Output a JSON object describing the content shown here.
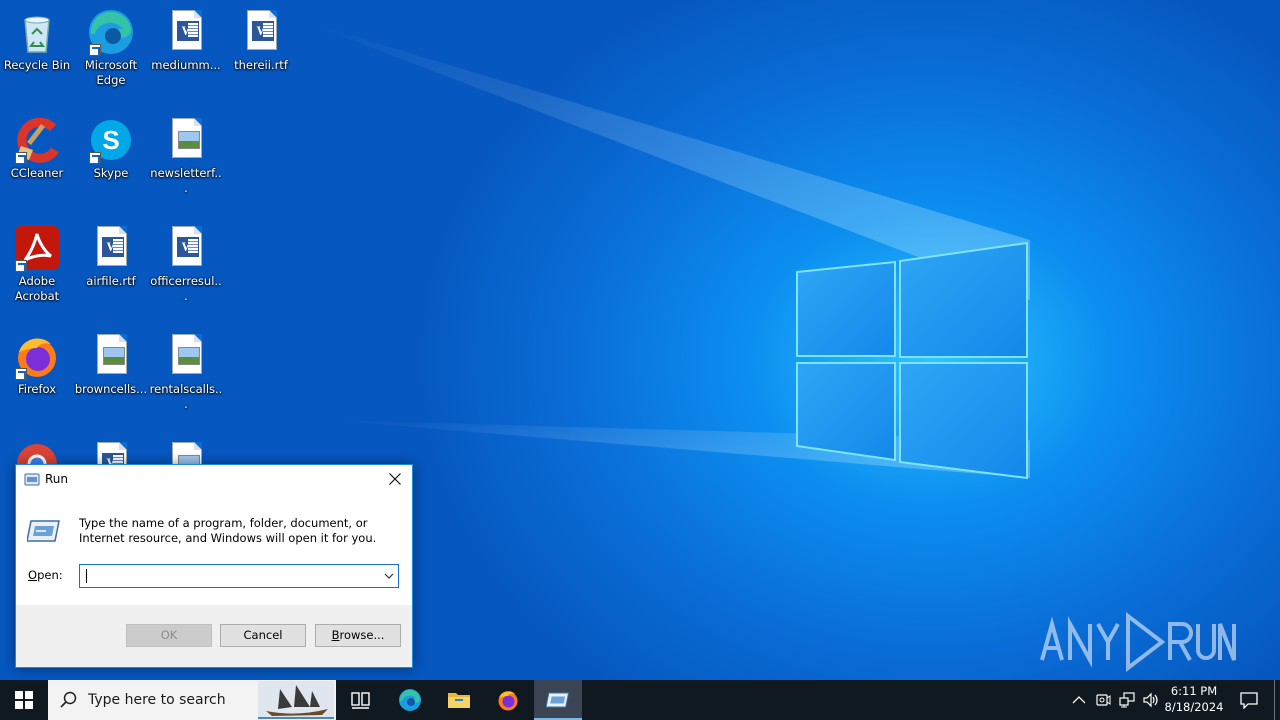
{
  "desktop": {
    "icons": [
      {
        "label": "Recycle Bin"
      },
      {
        "label": "Microsoft Edge"
      },
      {
        "label": "mediumm..."
      },
      {
        "label": "thereii.rtf"
      },
      {
        "label": "CCleaner"
      },
      {
        "label": "Skype"
      },
      {
        "label": "newsletterf..."
      },
      {
        "label": "Adobe Acrobat"
      },
      {
        "label": "airfile.rtf"
      },
      {
        "label": "officerresul..."
      },
      {
        "label": "Firefox"
      },
      {
        "label": "browncells..."
      },
      {
        "label": "rentalscalls..."
      }
    ]
  },
  "run_dialog": {
    "title": "Run",
    "description": "Type the name of a program, folder, document, or Internet resource, and Windows will open it for you.",
    "open_label": "Open:",
    "open_value": "",
    "buttons": {
      "ok": "OK",
      "cancel": "Cancel",
      "browse": "Browse..."
    }
  },
  "watermark": {
    "text": "ANY RUN"
  },
  "taskbar": {
    "search_placeholder": "Type here to search",
    "clock_time": "6:11 PM",
    "clock_date": "8/18/2024"
  },
  "colors": {
    "wallpaper": "#0a6cd6",
    "taskbar": "#101820",
    "dialog_border": "#1c8ad8",
    "accent": "#76b9ed"
  }
}
